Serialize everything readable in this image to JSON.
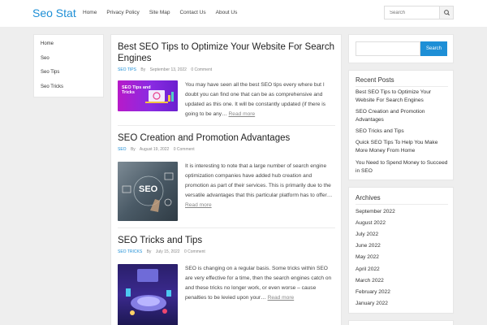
{
  "site": {
    "logo": "Seo Stat"
  },
  "nav": [
    "Home",
    "Privacy Policy",
    "Site Map",
    "Contact Us",
    "About Us"
  ],
  "header_search": {
    "placeholder": "Search"
  },
  "left_sidebar": {
    "items": [
      "Home",
      "Seo",
      "Seo Tips",
      "Seo Tricks"
    ]
  },
  "posts": [
    {
      "title": "Best SEO Tips to Optimize Your Website For Search Engines",
      "category": "SEO TIPS",
      "by": "By",
      "date": "September 13, 2022",
      "comments": "0 Comment",
      "thumb_text": "SEO Tips and Tricks",
      "excerpt": "You may have seen all the best SEO tips every where but I doubt you can find one that can be as comprehensive and updated as this one. It will be constantly updated (if there is going to be any…",
      "read_more": "Read more"
    },
    {
      "title": "SEO Creation and Promotion Advantages",
      "category": "SEO",
      "by": "By",
      "date": "August 19, 2022",
      "comments": "0 Comment",
      "thumb_text": "SEO",
      "excerpt": "It is interesting to note that a large number of search engine optimization companies have added hub creation and promotion as part of their services. This is primarily due to the versatile advantages that this particular platform has to offer…",
      "read_more": "Read more"
    },
    {
      "title": "SEO Tricks and Tips",
      "category": "SEO TRICKS",
      "by": "By",
      "date": "July 15, 2022",
      "comments": "0 Comment",
      "excerpt": "SEO is changing on a regular basis. Some tricks within SEO are very effective for a time, then the search engines catch on and these tricks no longer work, or even worse – cause penalties to be levied upon your…",
      "read_more": "Read more"
    }
  ],
  "right_search": {
    "placeholder": "",
    "button": "Search"
  },
  "recent_posts": {
    "title": "Recent Posts",
    "items": [
      "Best SEO Tips to Optimize Your Website For Search Engines",
      "SEO Creation and Promotion Advantages",
      "SEO Tricks and Tips",
      "Quick SEO Tips To Help You Make More Money From Home",
      "You Need to Spend Money to Succeed in SEO"
    ]
  },
  "archives": {
    "title": "Archives",
    "items": [
      "September 2022",
      "August 2022",
      "July 2022",
      "June 2022",
      "May 2022",
      "April 2022",
      "March 2022",
      "February 2022",
      "January 2022"
    ]
  },
  "colors": {
    "accent": "#1e8fd6",
    "background": "#eeeeee",
    "panel": "#ffffff"
  }
}
